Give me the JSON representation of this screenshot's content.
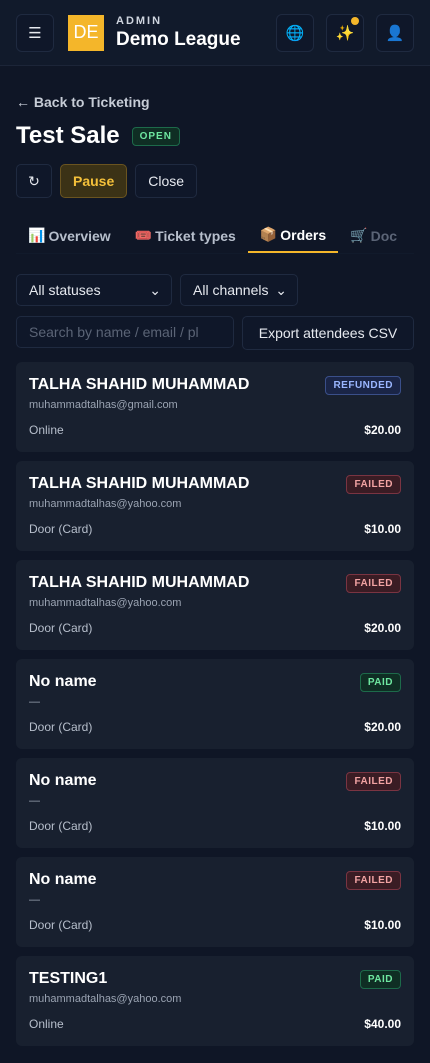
{
  "topbar": {
    "menu_icon": "hamburger-icon",
    "logo_text": "DE",
    "kicker": "ADMIN",
    "league_name": "Demo League",
    "icons": [
      "globe-icon",
      "sparkle-icon",
      "user-icon"
    ]
  },
  "header": {
    "back_label": "← Back to Ticketing",
    "title": "Test Sale",
    "status": "OPEN",
    "pause_label": "Pause",
    "close_label": "Close"
  },
  "tabs": [
    {
      "label": "Overview",
      "icon": "📊"
    },
    {
      "label": "Ticket types",
      "icon": "🎟️"
    },
    {
      "label": "Orders",
      "icon": "📦"
    },
    {
      "label": "Doc",
      "icon": "🛒"
    }
  ],
  "filters": {
    "status_value": "All statuses",
    "channel_value": "All channels",
    "search_placeholder": "Search by name / email / pl",
    "export_label": "Export attendees CSV"
  },
  "orders": [
    {
      "name": "TALHA SHAHID MUHAMMAD",
      "email": "muhammadtalhas@gmail.com",
      "status": "REFUNDED",
      "channel": "Online",
      "amount": "$20.00"
    },
    {
      "name": "TALHA SHAHID MUHAMMAD",
      "email": "muhammadtalhas@yahoo.com",
      "status": "FAILED",
      "channel": "Door (Card)",
      "amount": "$10.00"
    },
    {
      "name": "TALHA SHAHID MUHAMMAD",
      "email": "muhammadtalhas@yahoo.com",
      "status": "FAILED",
      "channel": "Door (Card)",
      "amount": "$20.00"
    },
    {
      "name": "No name",
      "email": "—",
      "status": "PAID",
      "channel": "Door (Card)",
      "amount": "$20.00"
    },
    {
      "name": "No name",
      "email": "—",
      "status": "FAILED",
      "channel": "Door (Card)",
      "amount": "$10.00"
    },
    {
      "name": "No name",
      "email": "—",
      "status": "FAILED",
      "channel": "Door (Card)",
      "amount": "$10.00"
    },
    {
      "name": "TESTING1",
      "email": "muhammadtalhas@yahoo.com",
      "status": "PAID",
      "channel": "Online",
      "amount": "$40.00"
    }
  ],
  "colors": {
    "background": "#0f1626",
    "accent": "#f4b62a",
    "card": "#18202f"
  }
}
